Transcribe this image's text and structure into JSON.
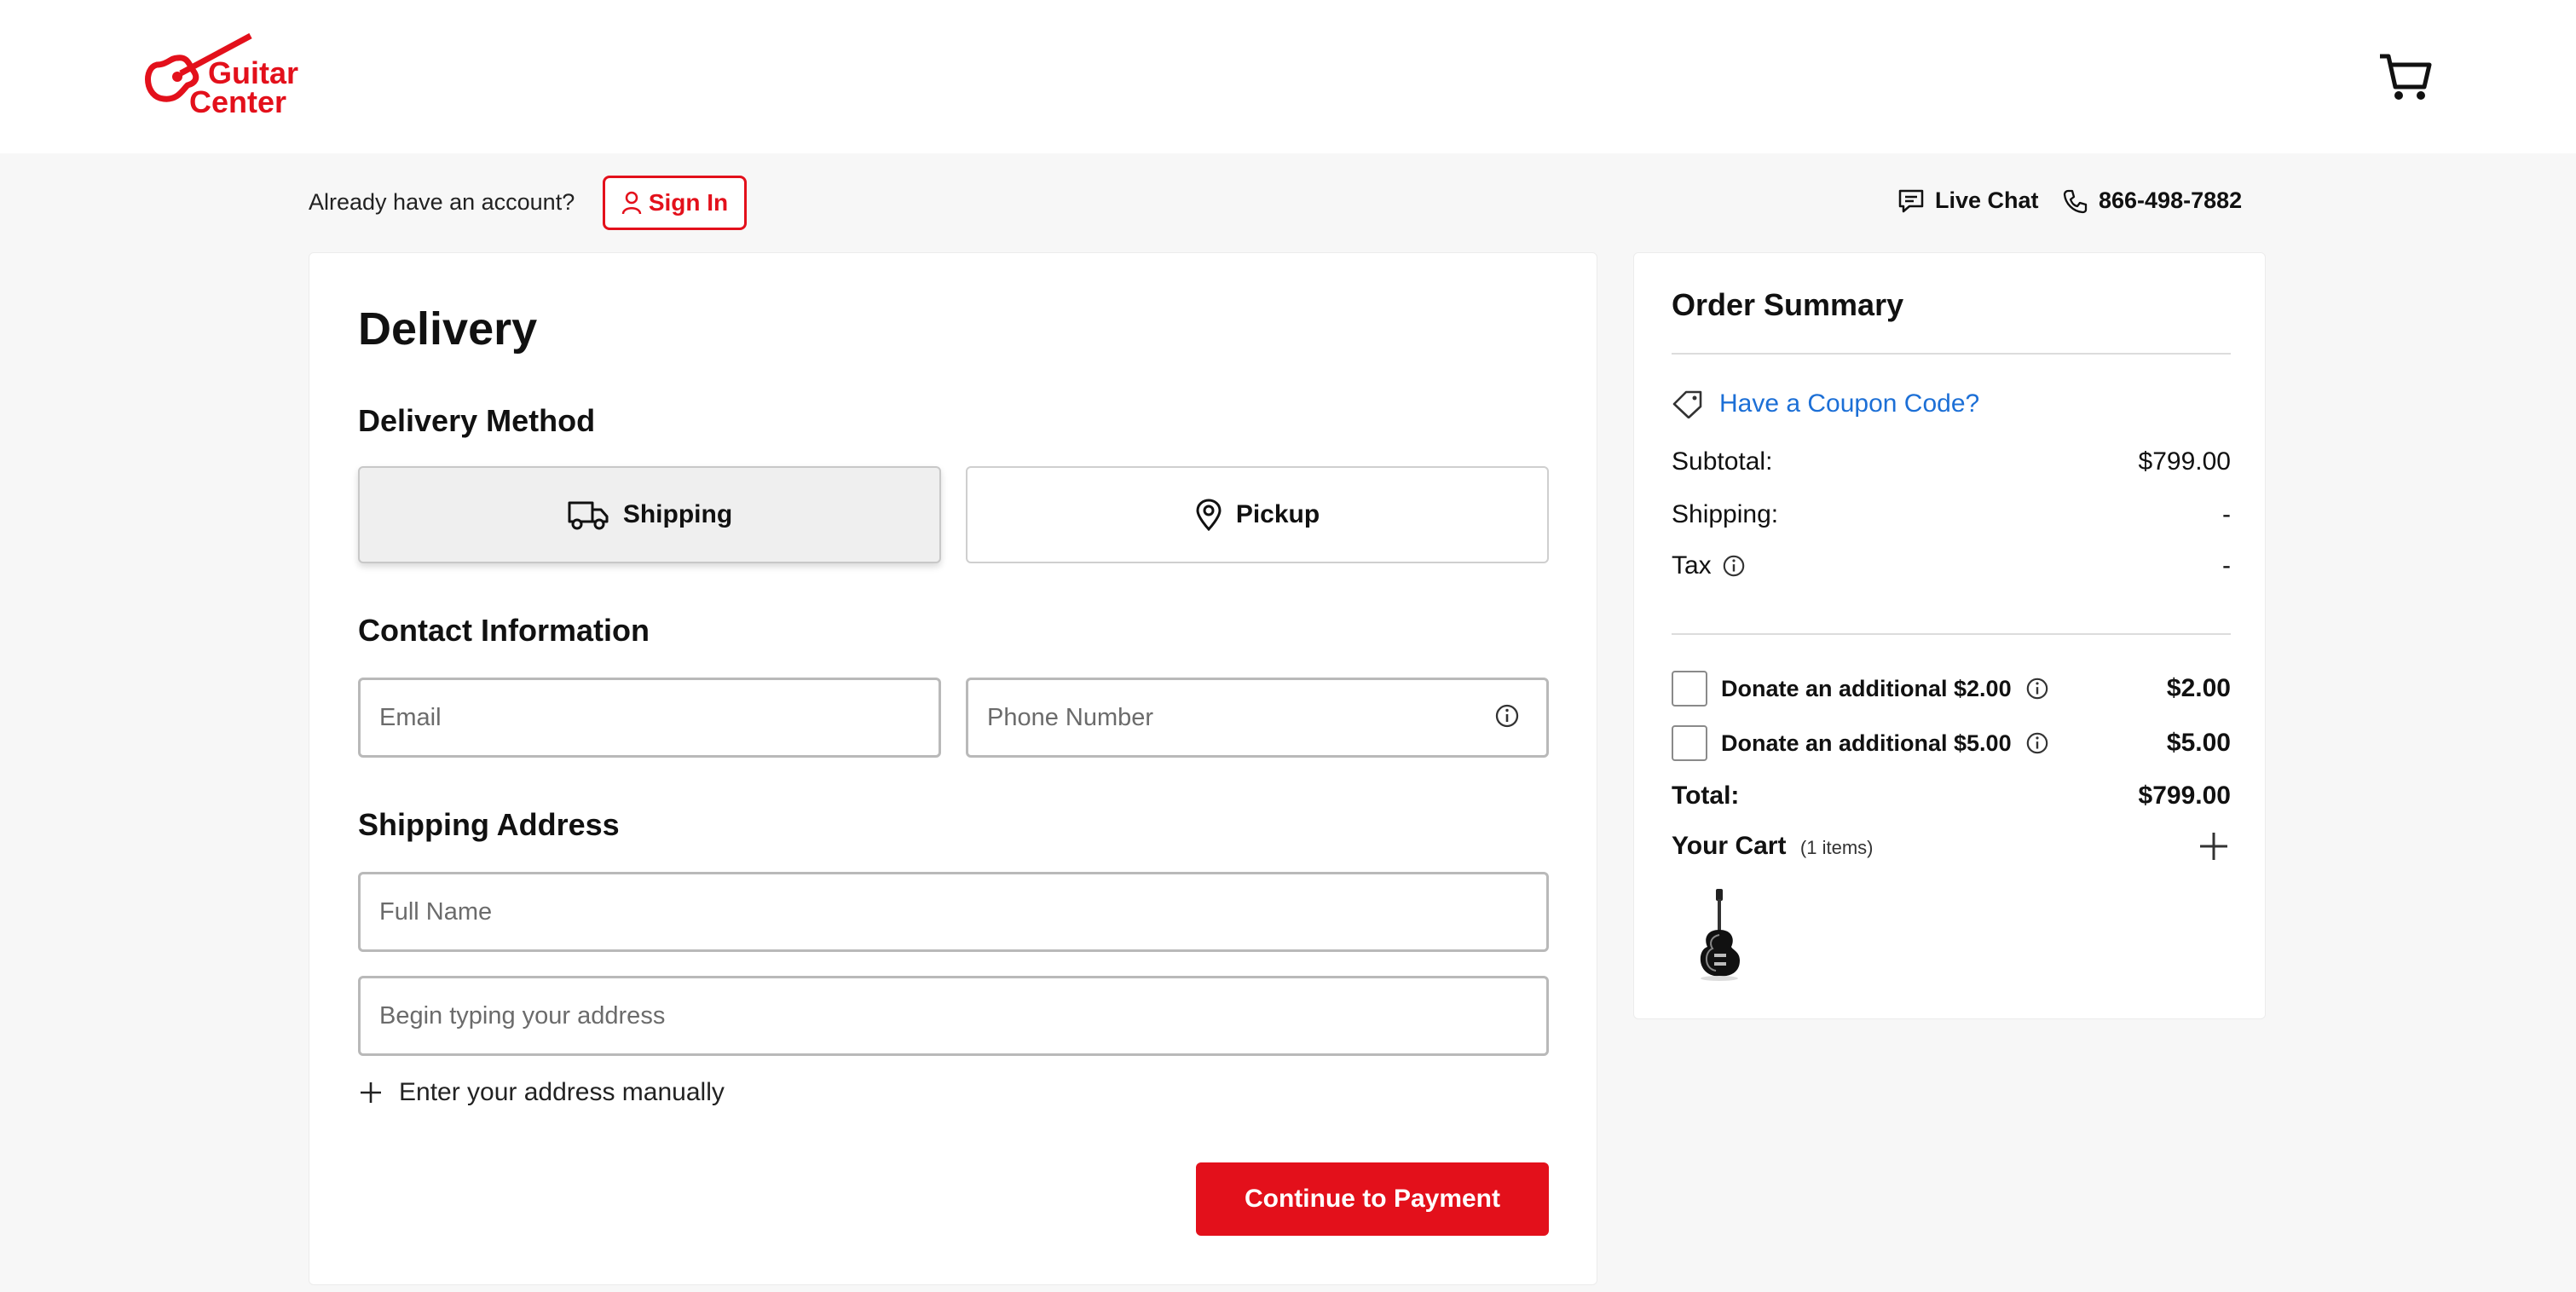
{
  "header": {
    "logo_lines": [
      "Guitar",
      "Center"
    ]
  },
  "account": {
    "prompt": "Already have an account?",
    "sign_in": "Sign In"
  },
  "help": {
    "live_chat": "Live Chat",
    "phone": "866-498-7882"
  },
  "delivery": {
    "title": "Delivery",
    "method_title": "Delivery Method",
    "methods": [
      {
        "label": "Shipping",
        "selected": true
      },
      {
        "label": "Pickup",
        "selected": false
      }
    ],
    "contact_title": "Contact Information",
    "email_placeholder": "Email",
    "phone_placeholder": "Phone Number",
    "address_title": "Shipping Address",
    "fullname_placeholder": "Full Name",
    "address_placeholder": "Begin typing your address",
    "manual_link": "Enter your address manually",
    "continue": "Continue to Payment"
  },
  "summary": {
    "title": "Order Summary",
    "coupon": "Have a Coupon Code?",
    "subtotal_label": "Subtotal:",
    "subtotal_value": "$799.00",
    "shipping_label": "Shipping:",
    "shipping_value": "-",
    "tax_label": "Tax",
    "tax_value": "-",
    "donations": [
      {
        "label": "Donate an additional $2.00",
        "amount": "$2.00"
      },
      {
        "label": "Donate an additional $5.00",
        "amount": "$5.00"
      }
    ],
    "total_label": "Total:",
    "total_value": "$799.00",
    "cart_label": "Your Cart",
    "cart_count": "(1 items)"
  },
  "colors": {
    "brand_red": "#e3101b",
    "link_blue": "#1c6fd6"
  },
  "icons": [
    "guitar-center-logo",
    "cart-icon",
    "user-icon",
    "chat-icon",
    "phone-icon",
    "truck-icon",
    "location-pin-icon",
    "info-icon",
    "plus-icon",
    "tag-icon"
  ]
}
